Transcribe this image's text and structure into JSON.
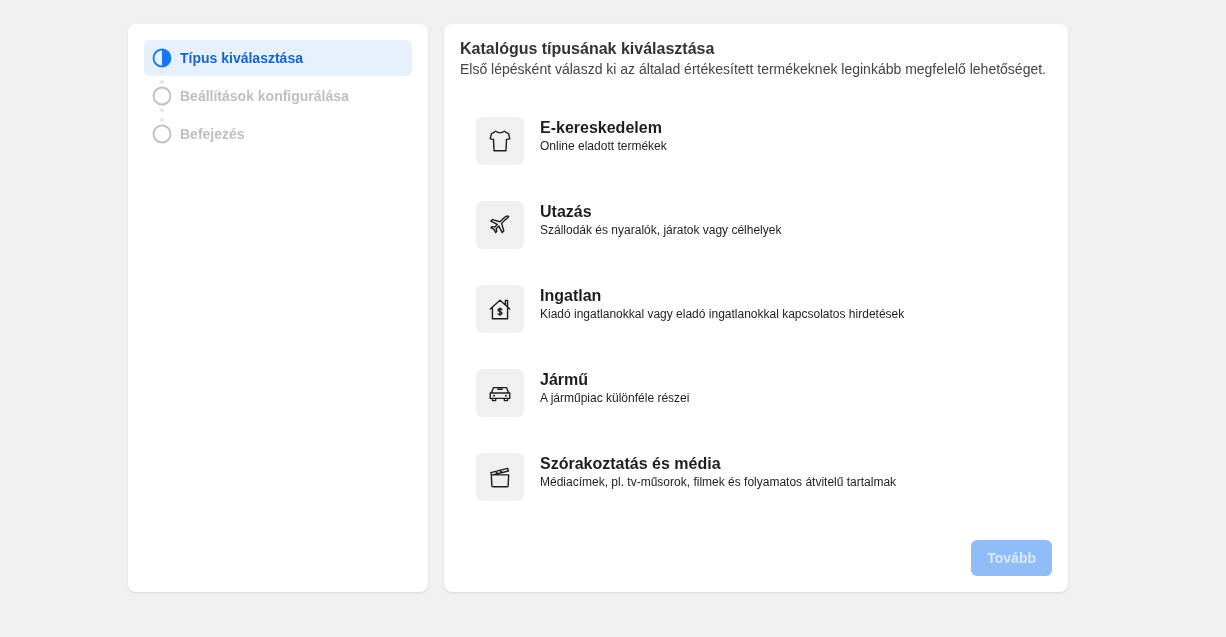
{
  "steps": [
    {
      "label": "Típus kiválasztása",
      "selected": true
    },
    {
      "label": "Beállítások konfigurálása",
      "selected": false
    },
    {
      "label": "Befejezés",
      "selected": false
    }
  ],
  "header": {
    "title": "Katalógus típusának kiválasztása",
    "subtitle": "Első lépésként válaszd ki az általad értékesített termékeknek leginkább megfelelő lehetőséget."
  },
  "options": [
    {
      "kind": "shirt",
      "title": "E-kereskedelem",
      "description": "Online eladott termékek"
    },
    {
      "kind": "plane",
      "title": "Utazás",
      "description": "Szállodák és nyaralók, járatok vagy célhelyek"
    },
    {
      "kind": "house",
      "title": "Ingatlan",
      "description": "Kiadó ingatlanokkal vagy eladó ingatlanokkal kapcsolatos hirdetések"
    },
    {
      "kind": "car",
      "title": "Jármű",
      "description": "A járműpiac különféle részei"
    },
    {
      "kind": "clapper",
      "title": "Szórakoztatás és média",
      "description": "Médiacímek, pl. tv-műsorok, filmek és folyamatos átvitelű tartalmak"
    }
  ],
  "next_button": {
    "label": "Tovább",
    "disabled": true
  }
}
